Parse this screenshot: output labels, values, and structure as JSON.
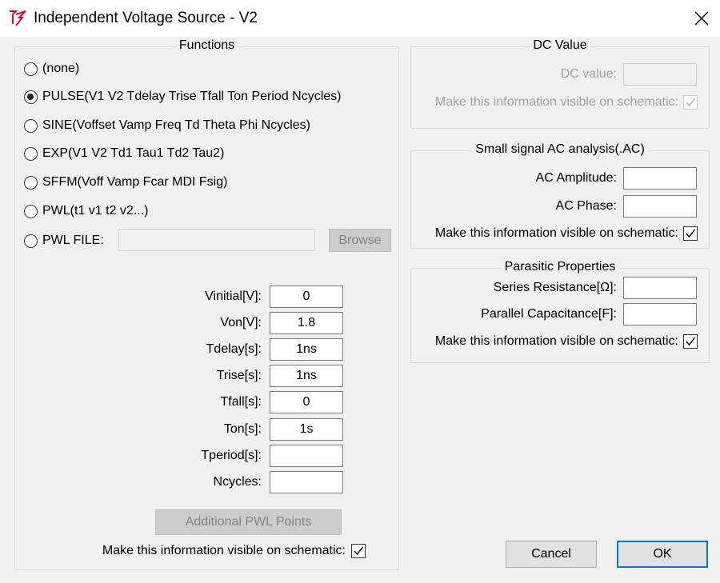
{
  "window": {
    "title": "Independent Voltage Source - V2"
  },
  "functions": {
    "title": "Functions",
    "options": [
      {
        "label": "(none)",
        "checked": false
      },
      {
        "label": "PULSE(V1 V2 Tdelay Trise Tfall Ton Period Ncycles)",
        "checked": true
      },
      {
        "label": "SINE(Voffset Vamp Freq Td Theta Phi Ncycles)",
        "checked": false
      },
      {
        "label": "EXP(V1 V2 Td1 Tau1 Td2 Tau2)",
        "checked": false
      },
      {
        "label": "SFFM(Voff Vamp Fcar MDI Fsig)",
        "checked": false
      },
      {
        "label": "PWL(t1 v1 t2 v2...)",
        "checked": false
      },
      {
        "label": "PWL FILE:",
        "checked": false
      }
    ],
    "pwl_file_value": "",
    "browse_label": "Browse",
    "params": [
      {
        "label": "Vinitial[V]:",
        "value": "0"
      },
      {
        "label": "Von[V]:",
        "value": "1.8"
      },
      {
        "label": "Tdelay[s]:",
        "value": "1ns"
      },
      {
        "label": "Trise[s]:",
        "value": "1ns"
      },
      {
        "label": "Tfall[s]:",
        "value": "0"
      },
      {
        "label": "Ton[s]:",
        "value": "1s"
      },
      {
        "label": "Tperiod[s]:",
        "value": ""
      },
      {
        "label": "Ncycles:",
        "value": ""
      }
    ],
    "additional_pwl_label": "Additional PWL Points",
    "visible_label": "Make this information visible on schematic:",
    "visible_checked": true
  },
  "dc": {
    "title": "DC Value",
    "value_label": "DC value:",
    "value": "",
    "visible_label": "Make this information visible on schematic:",
    "visible_checked": true
  },
  "ac": {
    "title": "Small signal AC analysis(.AC)",
    "amplitude_label": "AC Amplitude:",
    "amplitude_value": "",
    "phase_label": "AC Phase:",
    "phase_value": "",
    "visible_label": "Make this information visible on schematic:",
    "visible_checked": true
  },
  "parasitic": {
    "title": "Parasitic Properties",
    "series_label": "Series Resistance[Ω]:",
    "series_value": "",
    "parallel_label": "Parallel Capacitance[F]:",
    "parallel_value": "",
    "visible_label": "Make this information visible on schematic:",
    "visible_checked": true
  },
  "buttons": {
    "cancel": "Cancel",
    "ok": "OK"
  },
  "colors": {
    "accent": "#0078d7",
    "icon_red": "#c8102e"
  }
}
